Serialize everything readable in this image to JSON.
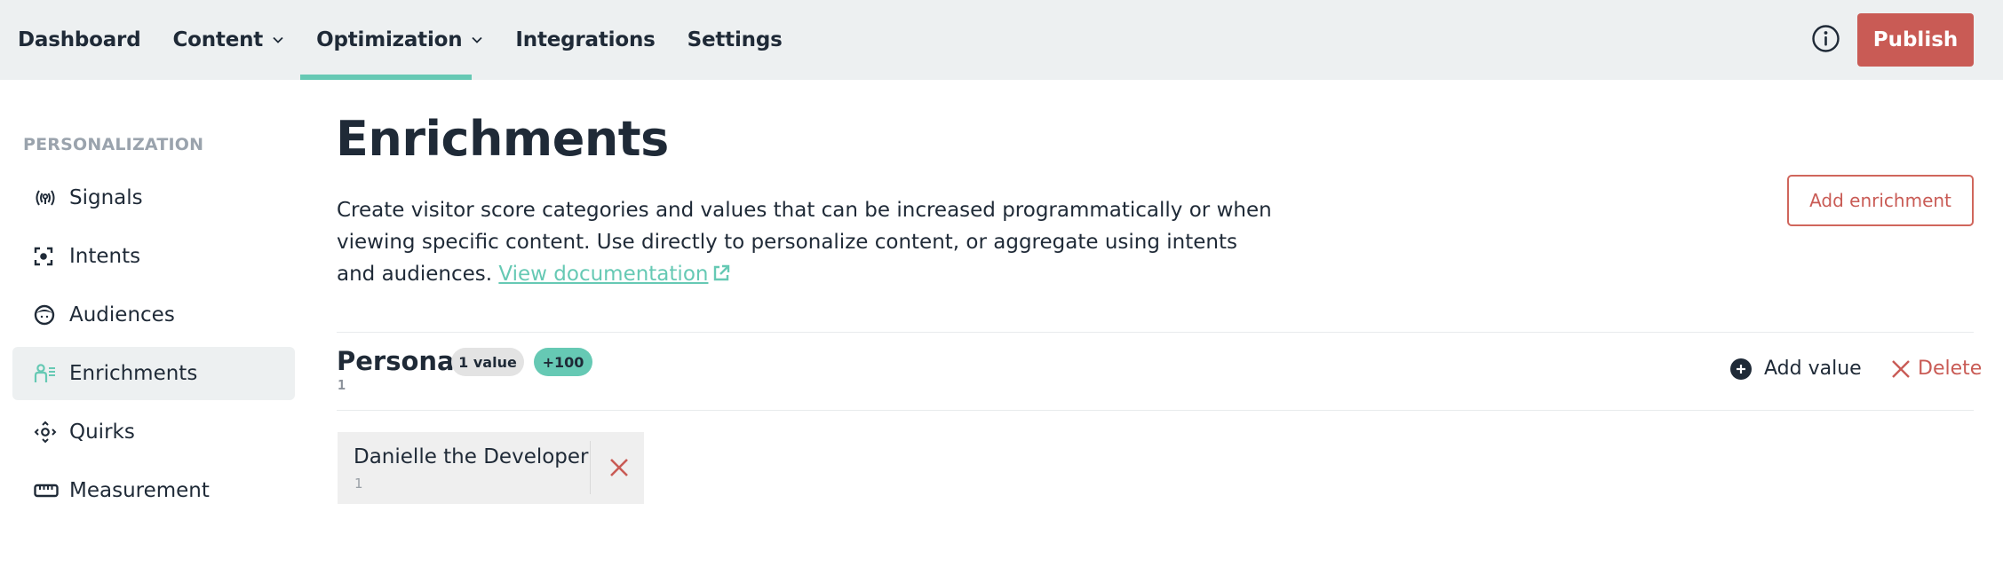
{
  "nav": {
    "items": [
      {
        "label": "Dashboard",
        "has_dropdown": false,
        "active": false
      },
      {
        "label": "Content",
        "has_dropdown": true,
        "active": false
      },
      {
        "label": "Optimization",
        "has_dropdown": true,
        "active": true
      },
      {
        "label": "Integrations",
        "has_dropdown": false,
        "active": false
      },
      {
        "label": "Settings",
        "has_dropdown": false,
        "active": false
      }
    ],
    "info_icon": "info-circle-icon",
    "publish_label": "Publish"
  },
  "colors": {
    "accent": "#66c9b4",
    "primary_button": "#c95b55",
    "nav_background": "#edf0f1",
    "text": "#1f2a37",
    "muted": "#9aa3ad"
  },
  "sidebar": {
    "heading": "PERSONALIZATION",
    "items": [
      {
        "label": "Signals",
        "icon": "signal-broadcast-icon",
        "active": false
      },
      {
        "label": "Intents",
        "icon": "focus-target-icon",
        "active": false
      },
      {
        "label": "Audiences",
        "icon": "face-icon",
        "active": false
      },
      {
        "label": "Enrichments",
        "icon": "user-list-icon",
        "active": true
      },
      {
        "label": "Quirks",
        "icon": "move-arrows-icon",
        "active": false
      },
      {
        "label": "Measurement",
        "icon": "ruler-icon",
        "active": false
      }
    ]
  },
  "main": {
    "title": "Enrichments",
    "description": "Create visitor score categories and values that can be increased programmatically or when viewing specific content. Use directly to personalize content, or aggregate using intents and audiences.",
    "doc_link_label": "View documentation",
    "add_enrichment_label": "Add enrichment",
    "enrichments": [
      {
        "name": "Persona",
        "value_count_badge": "1 value",
        "score_badge": "+100",
        "sub": "1",
        "add_value_label": "Add value",
        "delete_label": "Delete",
        "values": [
          {
            "name": "Danielle the Developer",
            "sub": "1"
          }
        ]
      }
    ]
  }
}
